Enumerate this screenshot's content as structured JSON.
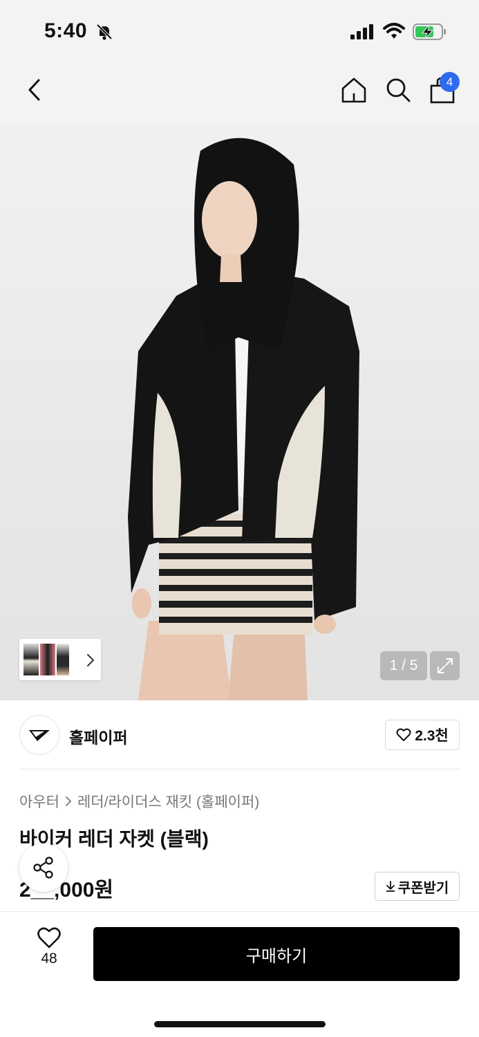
{
  "status_bar": {
    "time": "5:40"
  },
  "nav": {
    "cart_count": "4"
  },
  "gallery": {
    "counter": "1 / 5"
  },
  "brand": {
    "name": "홀페이퍼",
    "likes": "2.3천"
  },
  "product": {
    "breadcrumb": [
      "아우터",
      "레더/라이더스 재킷 (홀페이퍼)"
    ],
    "title": "바이커 레더 자켓 (블랙)",
    "price": "2__,000원",
    "coupon_label": "쿠폰받기"
  },
  "bottom_bar": {
    "wish_count": "48",
    "buy_label": "구매하기"
  },
  "colors": {
    "accent_badge": "#2f6bf0",
    "buy_button": "#000000"
  }
}
